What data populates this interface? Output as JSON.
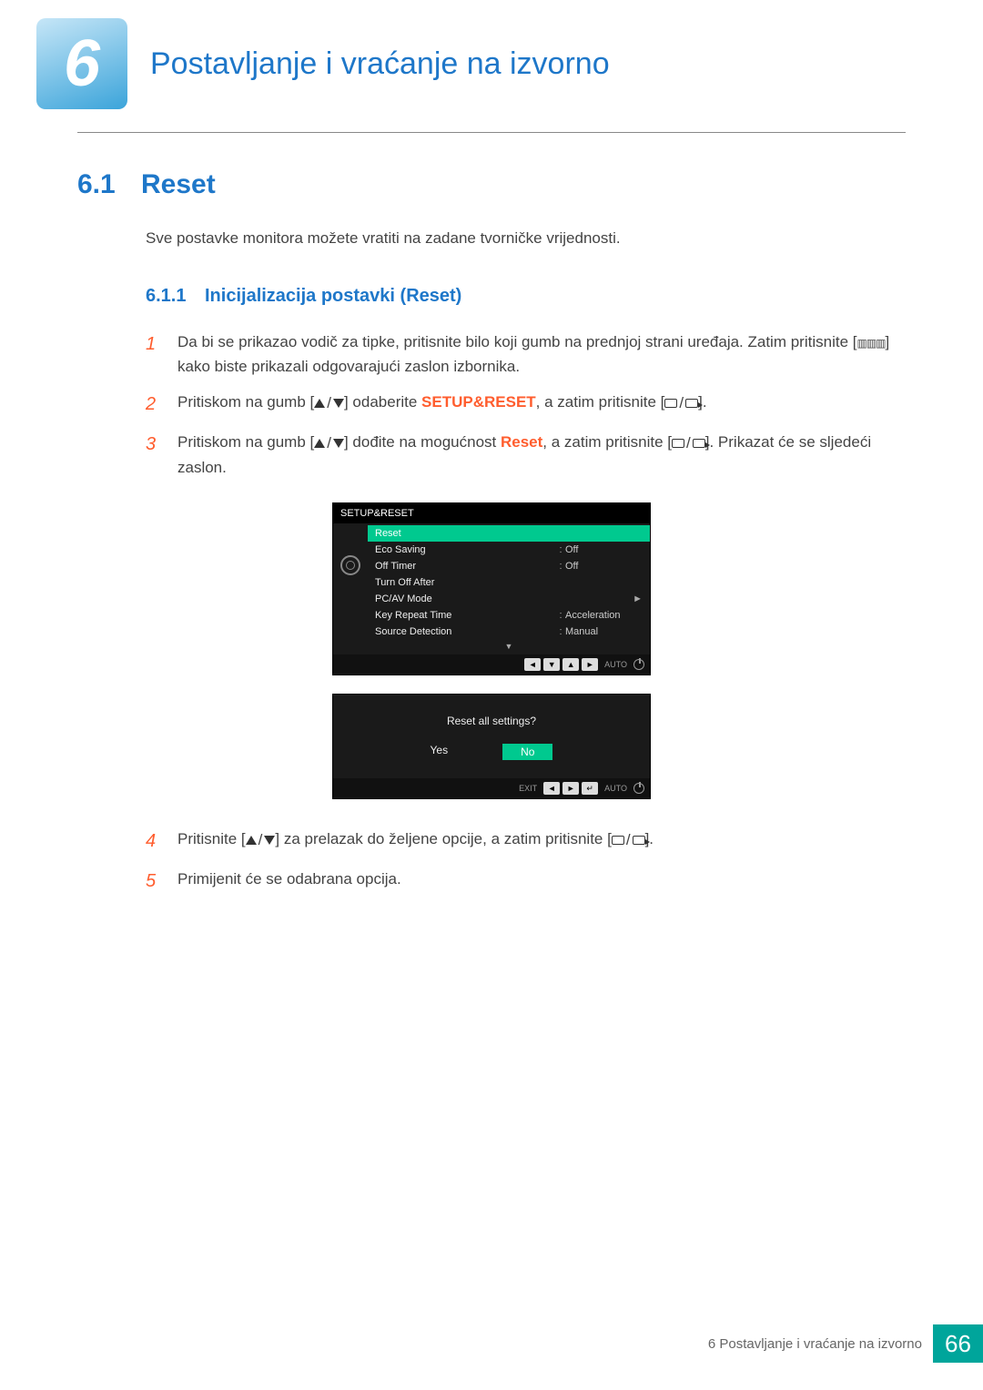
{
  "chapter": {
    "number": "6",
    "title": "Postavljanje i vraćanje na izvorno"
  },
  "section": {
    "number": "6.1",
    "title": "Reset"
  },
  "intro": "Sve postavke monitora možete vratiti na zadane tvorničke vrijednosti.",
  "subsection": {
    "number": "6.1.1",
    "title": "Inicijalizacija postavki (Reset)"
  },
  "steps": {
    "s1a": "Da bi se prikazao vodič za tipke, pritisnite bilo koji gumb na prednjoj strani uređaja. Zatim pritisnite",
    "s1b": "[",
    "s1c": "] kako biste prikazali odgovarajući zaslon izbornika.",
    "s2a": "Pritiskom na gumb [",
    "s2b": "] odaberite ",
    "s2hl": "SETUP&RESET",
    "s2c": ", a zatim pritisnite [",
    "s2d": "].",
    "s3a": "Pritiskom na gumb [",
    "s3b": "] dođite na mogućnost ",
    "s3hl": "Reset",
    "s3c": ", a zatim pritisnite [",
    "s3d": "]. Prikazat će se sljedeći zaslon.",
    "s4a": "Pritisnite [",
    "s4b": "] za prelazak do željene opcije, a zatim pritisnite [",
    "s4c": "].",
    "s5": "Primijenit će se odabrana opcija."
  },
  "osd1": {
    "title": "SETUP&RESET",
    "items": [
      {
        "label": "Reset",
        "val": "",
        "sel": true
      },
      {
        "label": "Eco Saving",
        "val": "Off"
      },
      {
        "label": "Off Timer",
        "val": "Off"
      },
      {
        "label": "Turn Off After",
        "val": ""
      },
      {
        "label": "PC/AV Mode",
        "val": "",
        "chev": true
      },
      {
        "label": "Key Repeat Time",
        "val": "Acceleration"
      },
      {
        "label": "Source Detection",
        "val": "Manual"
      }
    ],
    "nav_auto": "AUTO"
  },
  "osd2": {
    "question": "Reset all settings?",
    "yes": "Yes",
    "no": "No",
    "exit": "EXIT",
    "auto": "AUTO"
  },
  "footer": {
    "text": "6 Postavljanje i vraćanje na izvorno",
    "page": "66"
  }
}
